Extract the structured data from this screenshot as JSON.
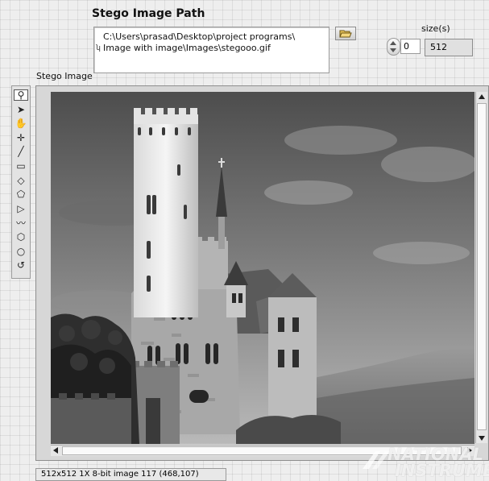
{
  "path_control": {
    "label": "Stego Image Path",
    "value_line1": "C:\\Users\\prasad\\Desktop\\project programs\\",
    "value_line2": "Image with image\\Images\\stegooo.gif",
    "browse_icon": "folder-open-icon"
  },
  "size_array": {
    "label": "size(s)",
    "index": "0",
    "value": "512"
  },
  "image_display": {
    "label": "Stego Image",
    "status": "512x512 1X 8-bit image 117    (468,107)"
  },
  "toolbar": {
    "tools": [
      {
        "name": "zoom-tool",
        "icon": "magnifier-icon",
        "glyph": "⚲"
      },
      {
        "name": "select-tool",
        "icon": "arrow-cursor-icon",
        "glyph": "➤"
      },
      {
        "name": "pan-tool",
        "icon": "hand-icon",
        "glyph": "✋"
      },
      {
        "name": "point-tool",
        "icon": "crosshair-icon",
        "glyph": "✛"
      },
      {
        "name": "line-tool",
        "icon": "line-icon",
        "glyph": "╱"
      },
      {
        "name": "rectangle-tool",
        "icon": "rectangle-icon",
        "glyph": "▭"
      },
      {
        "name": "rotated-rectangle-tool",
        "icon": "rotated-rectangle-icon",
        "glyph": "◇"
      },
      {
        "name": "annulus-tool",
        "icon": "annulus-icon",
        "glyph": "⬠"
      },
      {
        "name": "polyline-tool",
        "icon": "polyline-icon",
        "glyph": "▷"
      },
      {
        "name": "freehand-tool",
        "icon": "freehand-icon",
        "glyph": "〰"
      },
      {
        "name": "polygon-tool",
        "icon": "polygon-icon",
        "glyph": "⬡"
      },
      {
        "name": "oval-tool",
        "icon": "oval-icon",
        "glyph": "○"
      },
      {
        "name": "freehand-region-tool",
        "icon": "freehand-region-icon",
        "glyph": "↺"
      }
    ]
  },
  "watermark": {
    "line1": "NATIONAL",
    "line2": "INSTRUMENTS"
  }
}
